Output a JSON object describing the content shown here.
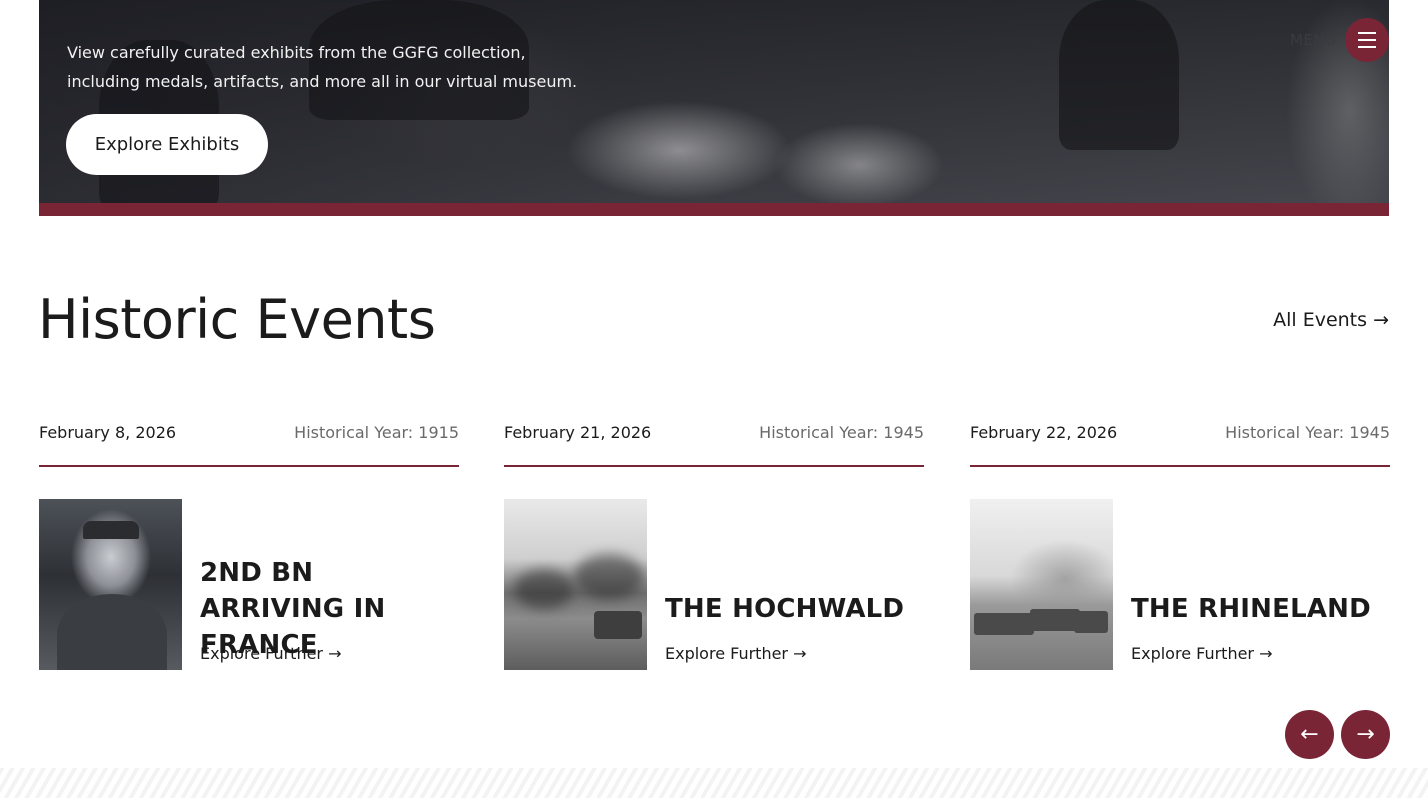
{
  "hero": {
    "description": "View carefully curated exhibits from the GGFG collection, including medals, artifacts, and more all in our virtual museum.",
    "button_label": "Explore Exhibits",
    "menu_label": "MENU"
  },
  "section": {
    "title": "Historic Events",
    "all_link_label": "All Events →"
  },
  "events": [
    {
      "date": "February 8, 2026",
      "year": "Historical Year: 1915",
      "title": "2ND BN ARRIVING IN FRANCE",
      "link": "Explore Further →"
    },
    {
      "date": "February 21, 2026",
      "year": "Historical Year: 1945",
      "title": "THE HOCHWALD",
      "link": "Explore Further →"
    },
    {
      "date": "February 22, 2026",
      "year": "Historical Year: 1945",
      "title": "THE RHINELAND",
      "link": "Explore Further →"
    }
  ],
  "carousel": {
    "prev_icon": "arrow-left-icon",
    "next_icon": "arrow-right-icon",
    "prev_glyph": "←",
    "next_glyph": "→"
  },
  "colors": {
    "accent": "#7a2536",
    "text": "#1b1b1b",
    "muted": "#6a6a6a"
  }
}
